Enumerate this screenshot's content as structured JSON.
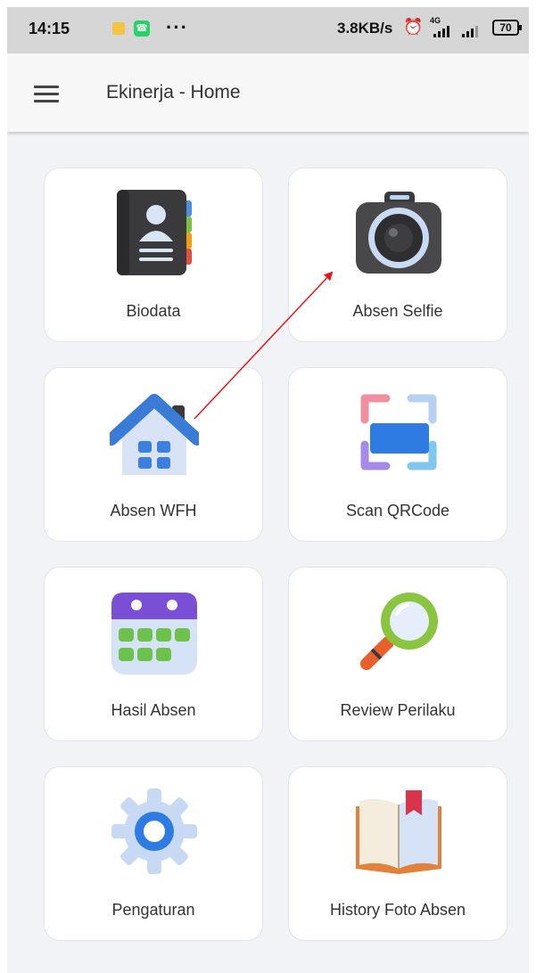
{
  "status_bar": {
    "time": "14:15",
    "overflow": "···",
    "network_speed": "3.8KB/s",
    "network_type": "4G",
    "battery": "70",
    "icons": [
      "notes-icon",
      "whatsapp-icon",
      "alarm-off-icon",
      "signal-icon",
      "battery-icon"
    ]
  },
  "app_bar": {
    "title": "Ekinerja - Home",
    "menu_icon": "hamburger-menu-icon"
  },
  "menu": [
    {
      "label": "Biodata",
      "icon": "contact-book-icon"
    },
    {
      "label": "Absen Selfie",
      "icon": "camera-icon"
    },
    {
      "label": "Absen WFH",
      "icon": "house-icon"
    },
    {
      "label": "Scan QRCode",
      "icon": "scan-frame-icon"
    },
    {
      "label": "Hasil Absen",
      "icon": "calendar-icon"
    },
    {
      "label": "Review Perilaku",
      "icon": "magnifier-icon"
    },
    {
      "label": "Pengaturan",
      "icon": "gear-icon"
    },
    {
      "label": "History Foto Absen",
      "icon": "open-book-icon"
    }
  ],
  "colors": {
    "background": "#f2f3f7",
    "annotation_arrow": "#e8141a"
  }
}
